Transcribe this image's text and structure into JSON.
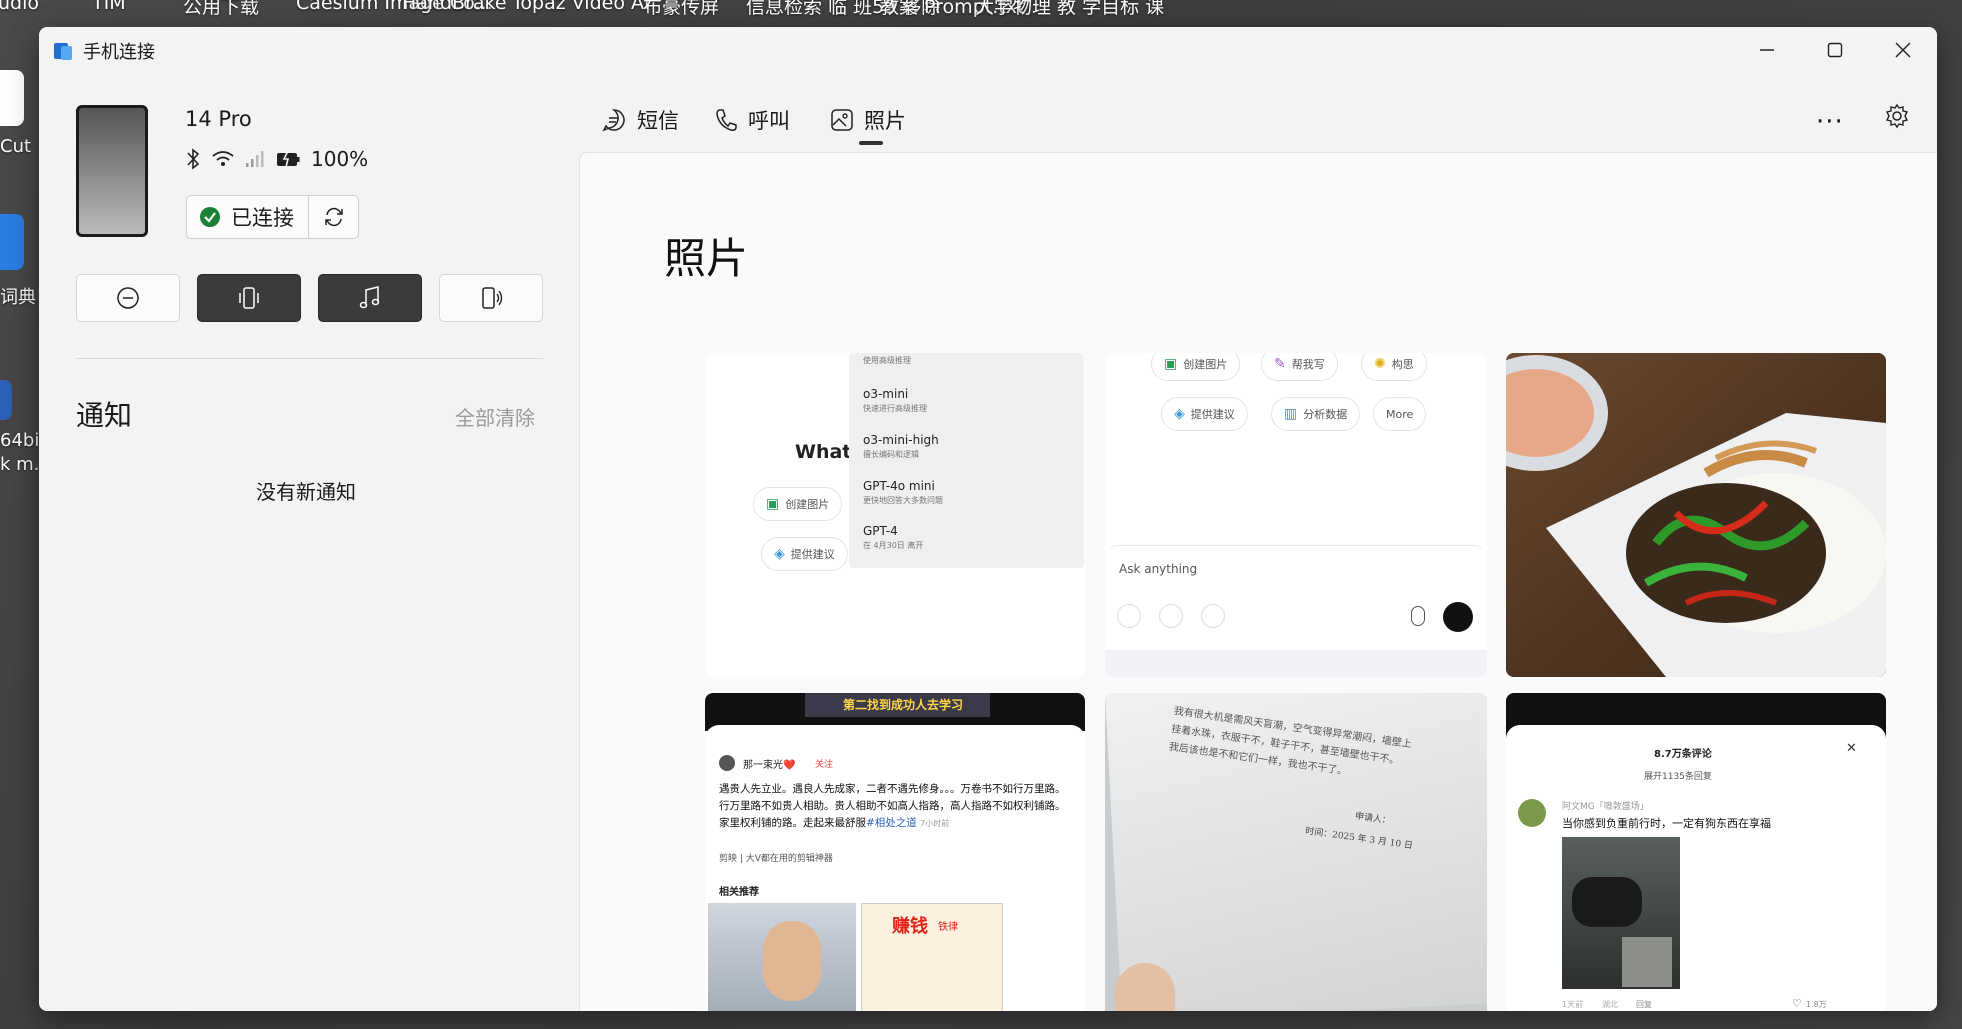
{
  "desktop": {
    "top_labels": [
      "udio",
      "TIM",
      "公用下载",
      "Caesium Image Co...",
      "HandBrake",
      "Topaz Video AI",
      "布豪传屏",
      "信息检索 临 班59 移除",
      "教案 Prompt.txt",
      "大学物理 教 学目标 课"
    ],
    "left_labels": [
      "Cut",
      "词典",
      "64bi",
      "k m."
    ]
  },
  "window": {
    "title": "手机连接"
  },
  "device": {
    "name": "14 Pro",
    "battery": "100%",
    "connection_label": "已连接",
    "connected_color": "#1a7f37"
  },
  "notifications": {
    "title": "通知",
    "clear_label": "全部清除",
    "empty_label": "没有新通知"
  },
  "tabs": [
    {
      "label": "短信",
      "icon": "message-icon"
    },
    {
      "label": "呼叫",
      "icon": "phone-icon"
    },
    {
      "label": "照片",
      "icon": "photo-icon",
      "selected": true
    }
  ],
  "main": {
    "title": "照片",
    "more_label": "···"
  },
  "photos": {
    "p1": {
      "what_text": "What",
      "menu": [
        {
          "title": "",
          "sub": "使用高级推理"
        },
        {
          "title": "o3-mini",
          "sub": "快速进行高级推理"
        },
        {
          "title": "o3-mini-high",
          "sub": "擅长编码和逻辑"
        },
        {
          "title": "GPT-4o mini",
          "sub": "更快地回答大多数问题"
        },
        {
          "title": "GPT-4",
          "sub": "在 4月30日 离开"
        }
      ],
      "chips": [
        "创建图片",
        "提供建议"
      ]
    },
    "p2": {
      "chips_row1": [
        "创建图片",
        "帮我写",
        "构思"
      ],
      "chips_row2": [
        "提供建议",
        "分析数据",
        "More"
      ],
      "ask_placeholder": "Ask anything"
    },
    "p4": {
      "video_caption": "第二找到成功人去学习",
      "author": "那一束光❤️",
      "follow": "关注",
      "body": "遇贵人先立业。遇良人先成家，二者不遇先修身。。。万卷书不如行万里路。行万里路不如贵人相助。贵人相助不如高人指路，高人指路不如权利铺路。家里权利铺的路。走起来最舒服",
      "hashtag": "#相处之道",
      "time": "7小时前",
      "jianying": "剪映 | 大V都在用的剪辑神器",
      "related": "相关推荐",
      "thumb2_title": "赚钱",
      "thumb2_tag": "铁律"
    },
    "p5": {
      "handwriting": [
        "我有很大机是需风天盲潮，空气变得异常潮闷，墙壁上",
        "挂着水珠，衣服干不，鞋子干不，甚至墙壁也干不。",
        "我后该也是不和它们一样，我也不干了。"
      ],
      "signer": "申请人：",
      "date": "时间：2025 年 3 月 10 日"
    },
    "p6": {
      "comment_count": "8.7万条评论",
      "expand": "展开1135条回复",
      "user": "阿文MG「嗷敦盛场」",
      "comment": "当你感到负重前行时，一定有狗东西在享福",
      "meta_time": "1天前",
      "meta_loc": "湖北",
      "meta_reply": "回复",
      "likes": "1.8万"
    }
  }
}
